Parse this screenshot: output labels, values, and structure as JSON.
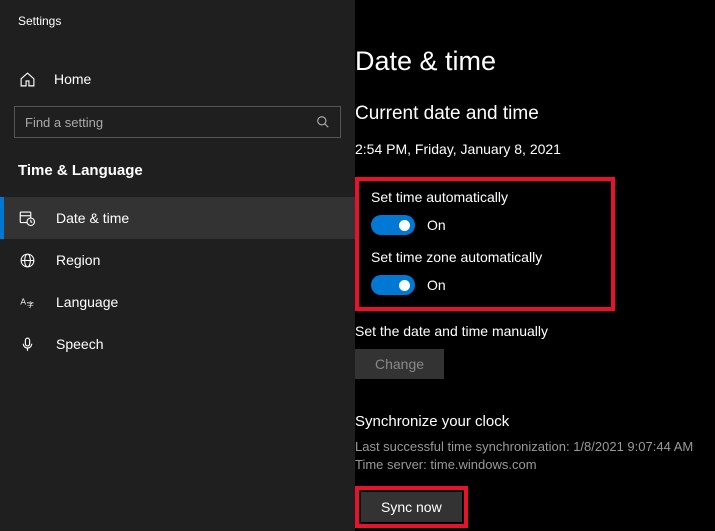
{
  "header": {
    "title": "Settings"
  },
  "home": {
    "label": "Home"
  },
  "search": {
    "placeholder": "Find a setting"
  },
  "category": {
    "title": "Time & Language"
  },
  "nav": {
    "items": [
      {
        "label": "Date & time"
      },
      {
        "label": "Region"
      },
      {
        "label": "Language"
      },
      {
        "label": "Speech"
      }
    ]
  },
  "main": {
    "title": "Date & time",
    "subtitle": "Current date and time",
    "datetime": "2:54 PM, Friday, January 8, 2021",
    "auto_time": {
      "label": "Set time automatically",
      "state": "On"
    },
    "auto_zone": {
      "label": "Set time zone automatically",
      "state": "On"
    },
    "manual": {
      "label": "Set the date and time manually",
      "button": "Change"
    },
    "sync": {
      "title": "Synchronize your clock",
      "last": "Last successful time synchronization: 1/8/2021 9:07:44 AM",
      "server": "Time server: time.windows.com",
      "button": "Sync now"
    }
  }
}
